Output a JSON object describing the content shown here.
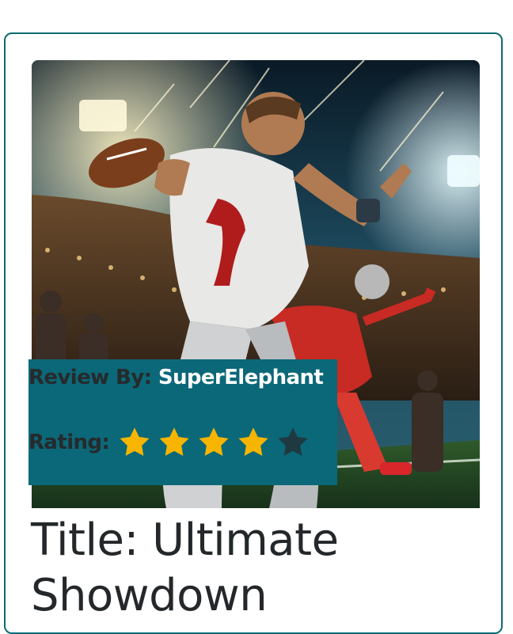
{
  "review": {
    "label": "Review By:",
    "username": "SuperElephant"
  },
  "rating": {
    "label": "Rating:",
    "value": 4,
    "max": 5,
    "filled_color": "#f7b500",
    "empty_color": "#1e3a40"
  },
  "game": {
    "title": "Title: Ultimate Showdown"
  },
  "colors": {
    "card_border": "#0b6b73",
    "overlay_background": "#0b6878",
    "username_text": "#ffffff",
    "label_text": "#262a2c"
  }
}
